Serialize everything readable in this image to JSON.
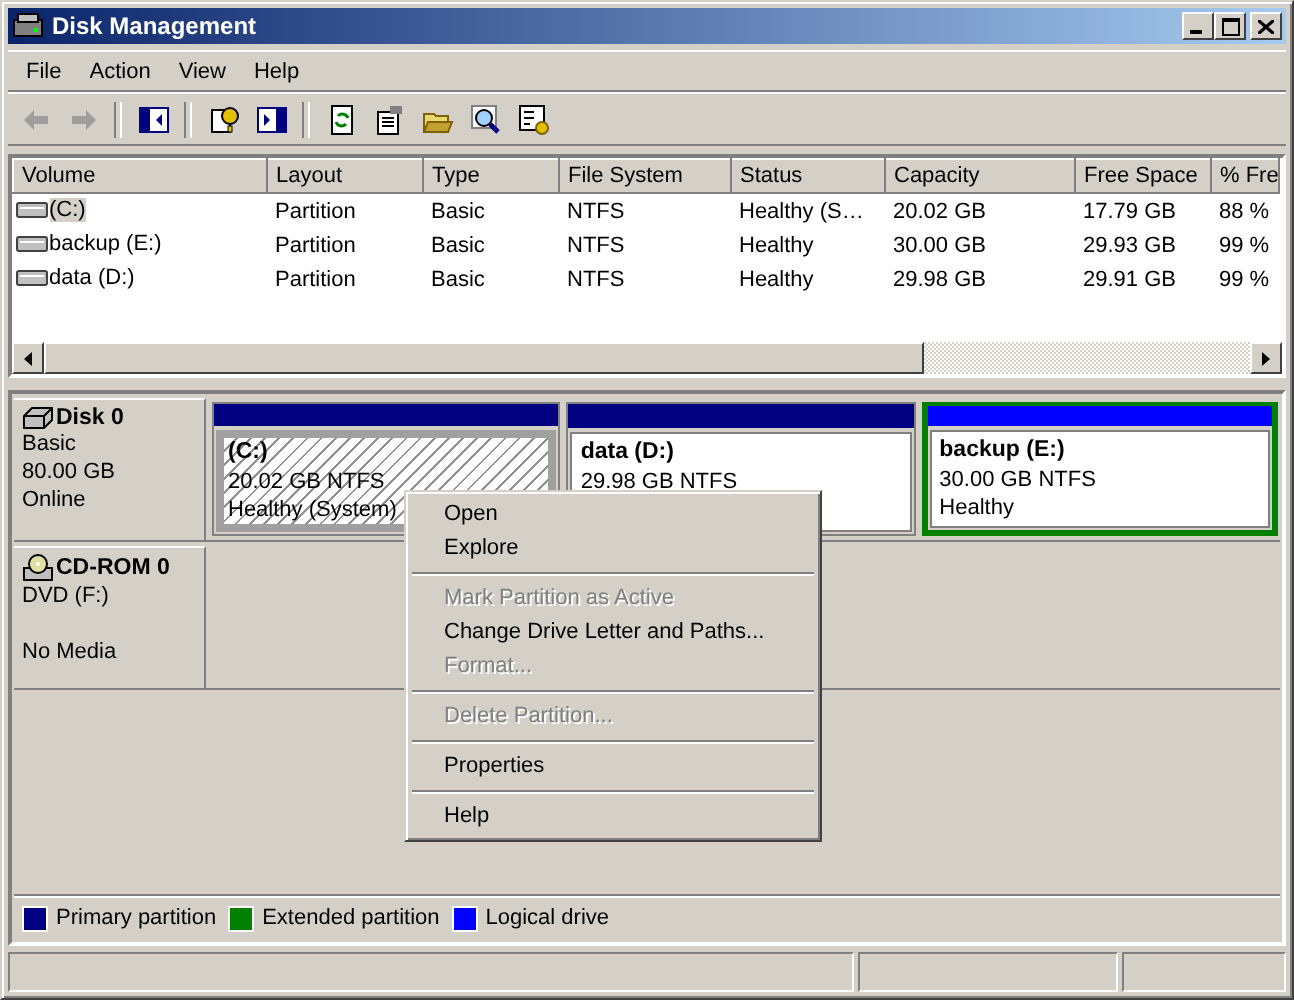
{
  "window": {
    "title": "Disk Management"
  },
  "menu": [
    {
      "label": "File"
    },
    {
      "label": "Action"
    },
    {
      "label": "View"
    },
    {
      "label": "Help"
    }
  ],
  "toolbar": [
    {
      "kind": "back",
      "disabled": true
    },
    {
      "kind": "forward",
      "disabled": true
    },
    {
      "kind": "sep"
    },
    {
      "kind": "tree",
      "disabled": false
    },
    {
      "kind": "sep"
    },
    {
      "kind": "help",
      "disabled": false
    },
    {
      "kind": "pane",
      "disabled": false
    },
    {
      "kind": "sep"
    },
    {
      "kind": "refresh",
      "disabled": false
    },
    {
      "kind": "properties",
      "disabled": false
    },
    {
      "kind": "open",
      "disabled": false
    },
    {
      "kind": "search",
      "disabled": false
    },
    {
      "kind": "settings",
      "disabled": false
    }
  ],
  "table": {
    "columns": [
      "Volume",
      "Layout",
      "Type",
      "File System",
      "Status",
      "Capacity",
      "Free Space",
      "% Fre"
    ],
    "rows": [
      {
        "selected": true,
        "cells": [
          " (C:)",
          "Partition",
          "Basic",
          "NTFS",
          "Healthy (S…",
          "20.02 GB",
          "17.79 GB",
          "88 %"
        ]
      },
      {
        "selected": false,
        "cells": [
          "backup (E:)",
          "Partition",
          "Basic",
          "NTFS",
          "Healthy",
          "30.00 GB",
          "29.93 GB",
          "99 %"
        ]
      },
      {
        "selected": false,
        "cells": [
          "data (D:)",
          "Partition",
          "Basic",
          "NTFS",
          "Healthy",
          "29.98 GB",
          "29.91 GB",
          "99 %"
        ]
      }
    ]
  },
  "disks": [
    {
      "kind": "disk",
      "name": "Disk 0",
      "lines": [
        "Basic",
        "80.00 GB",
        "Online"
      ],
      "partitions": [
        {
          "name": " (C:)",
          "size": "20.02 GB NTFS",
          "status": "Healthy (System)",
          "color": "#000080",
          "hatched": true,
          "selected": true,
          "extended": false
        },
        {
          "name": "data  (D:)",
          "size": "29.98 GB NTFS",
          "color": "#000080",
          "hatched": false,
          "selected": false,
          "extended": false
        },
        {
          "name": "backup  (E:)",
          "size": "30.00 GB NTFS",
          "status": "Healthy",
          "color": "#0000ff",
          "hatched": false,
          "selected": false,
          "extended": true
        }
      ]
    },
    {
      "kind": "cdrom",
      "name": "CD-ROM 0",
      "lines": [
        "DVD (F:)",
        "No Media"
      ]
    }
  ],
  "context_menu": [
    {
      "kind": "item",
      "label": "Open",
      "disabled": false
    },
    {
      "kind": "item",
      "label": "Explore",
      "disabled": false
    },
    {
      "kind": "separator"
    },
    {
      "kind": "item",
      "label": "Mark Partition as Active",
      "disabled": true
    },
    {
      "kind": "item",
      "label": "Change Drive Letter and Paths...",
      "disabled": false
    },
    {
      "kind": "item",
      "label": "Format...",
      "disabled": true
    },
    {
      "kind": "separator"
    },
    {
      "kind": "item",
      "label": "Delete Partition...",
      "disabled": true
    },
    {
      "kind": "separator"
    },
    {
      "kind": "item",
      "label": "Properties",
      "disabled": false
    },
    {
      "kind": "separator"
    },
    {
      "kind": "item",
      "label": "Help",
      "disabled": false
    }
  ],
  "legend": [
    {
      "label": "Primary partition",
      "color": "#000080"
    },
    {
      "label": "Extended partition",
      "color": "#008000"
    },
    {
      "label": "Logical drive",
      "color": "#0000ff"
    }
  ]
}
